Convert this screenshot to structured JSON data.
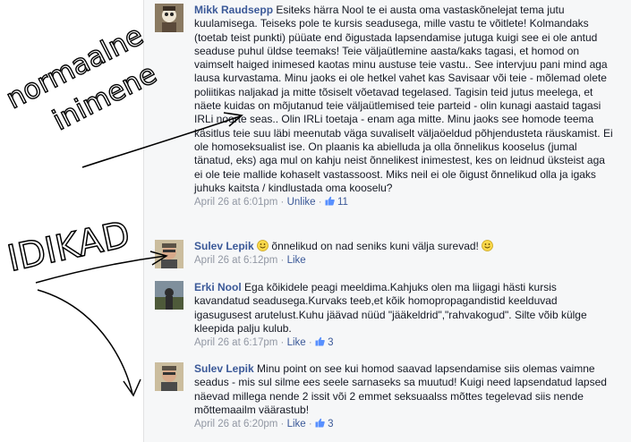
{
  "comments": [
    {
      "author": "Mikk Raudsepp",
      "text": "Esiteks härra Nool te ei austa oma vastaskõnelejat tema jutu kuulamisega. Teiseks pole te kursis seadusega, mille vastu te võitlete! Kolmandaks (toetab teist punkti) püüate end õigustada lapsendamise jutuga kuigi see ei ole antud seaduse puhul üldse teemaks! Teie väljaütlemine aasta/kaks tagasi, et homod on vaimselt haiged inimesed kaotas minu austuse teie vastu.. See intervjuu pani mind aga lausa kurvastama. Minu jaoks ei ole hetkel vahet kas Savisaar või teie - mõlemad olete poliitikas naljakad ja mitte tõsiselt võetavad tegelased. Tagisin teid jutus meelega, et näete kuidas on mõjutanud teie väljaütlemised teie parteid - olin kunagi aastaid tagasi IRLi noorte seas.. Olin IRLi toetaja - enam aga mitte. Minu jaoks see homode teema käsitlus teie suu läbi meenutab väga suvaliselt väljaöeldud põhjendusteta räuskamist. Ei ole homoseksualist ise. On plaanis ka abielluda ja olla õnnelikus kooselus (jumal tänatud, eks) aga mul on kahju neist õnnelikest inimestest, kes on leidnud üksteist aga ei ole teie mallide kohaselt vastassoost. Miks neil ei ole õigust õnnelikud olla ja igaks juhuks kaitsta / kindlustada oma kooselu?",
      "time": "April 26 at 6:01pm",
      "action": "Unlike",
      "likes": "11"
    },
    {
      "author": "Sulev Lepik",
      "text": "õnnelikud on nad seniks kuni välja surevad!",
      "time": "April 26 at 6:12pm",
      "action": "Like"
    },
    {
      "author": "Erki Nool",
      "text": "Ega kõikidele peagi meeldima.Kahjuks olen ma liigagi hästi kursis kavandatud seadusega.Kurvaks teeb,et kõik homopropagandistid keelduvad igasugusest arutelust.Kuhu jäävad nüüd \"jääkeldrid\",\"rahvakogud\". Silte võib külge kleepida palju kulub.",
      "time": "April 26 at 6:17pm",
      "action": "Like",
      "likes": "3"
    },
    {
      "author": "Sulev Lepik",
      "text": "Minu point on see kui homod saavad lapsendamise siis olemas vaimne seadus - mis sul silme ees seele sarnaseks sa muutud! Kuigi need lapsendatud lapsed näevad millega nende 2 issit või 2 emmet seksuaalss mõttes tegelevad siis nende mõttemaailm väärastub!",
      "time": "April 26 at 6:20pm",
      "action": "Like",
      "likes": "3"
    }
  ],
  "annotations": {
    "word1": "normaalne",
    "word2": "inimene",
    "word3": "IDIKAD"
  },
  "separator": "·",
  "colors": {
    "link": "#3b5998",
    "meta": "#9197a3",
    "bg": "#f6f7f8",
    "ink": "#000000"
  }
}
